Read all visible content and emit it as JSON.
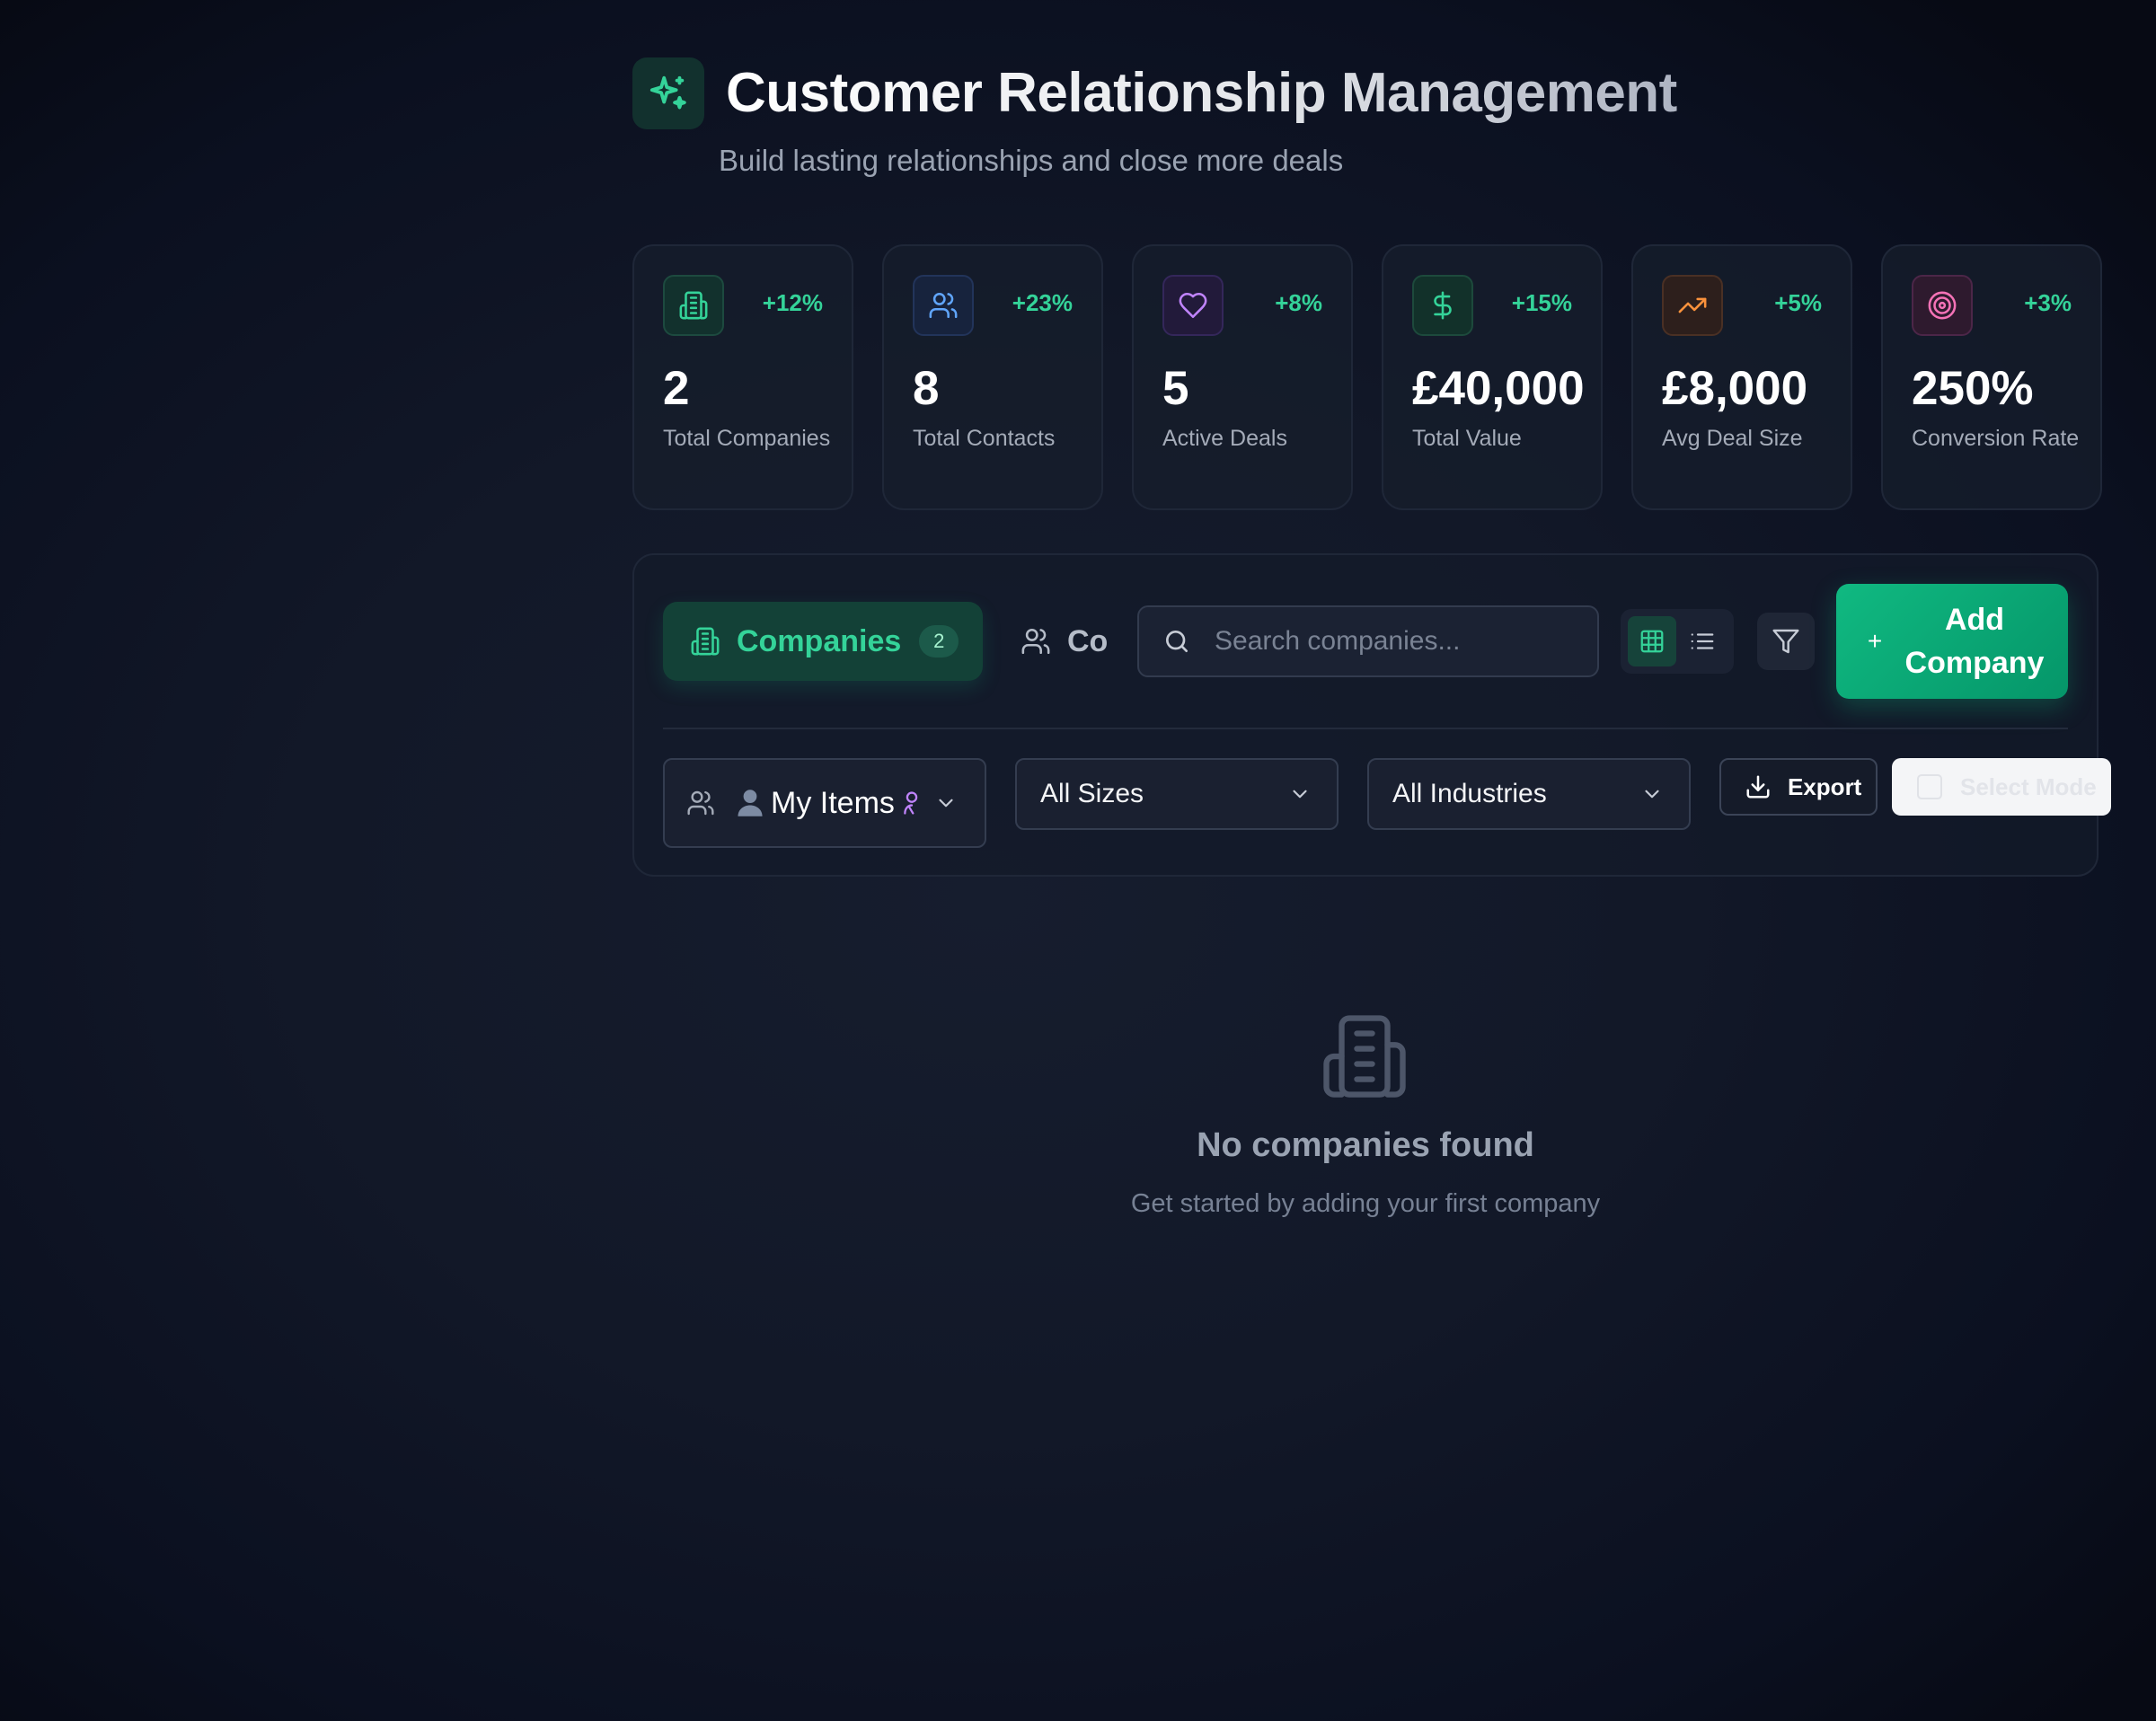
{
  "header": {
    "title": "Customer Relationship Management",
    "subtitle": "Build lasting relationships and close more deals",
    "logo_icon": "sparkles-icon"
  },
  "stats": [
    {
      "icon": "building-icon",
      "change": "+12%",
      "value": "2",
      "label": "Total Companies",
      "accent": "#34d399"
    },
    {
      "icon": "users-icon",
      "change": "+23%",
      "value": "8",
      "label": "Total Contacts",
      "accent": "#60a5fa"
    },
    {
      "icon": "heart-icon",
      "change": "+8%",
      "value": "5",
      "label": "Active Deals",
      "accent": "#c084fc"
    },
    {
      "icon": "dollar-icon",
      "change": "+15%",
      "value": "£40,000",
      "label": "Total Value",
      "accent": "#34d399"
    },
    {
      "icon": "trending-up-icon",
      "change": "+5%",
      "value": "£8,000",
      "label": "Avg Deal Size",
      "accent": "#fb923c"
    },
    {
      "icon": "target-icon",
      "change": "+3%",
      "value": "250%",
      "label": "Conversion Rate",
      "accent": "#f472b6"
    }
  ],
  "tabs": {
    "companies": {
      "label": "Companies",
      "count": "2",
      "icon": "building-icon"
    },
    "contacts": {
      "label": "Co",
      "icon": "users-icon"
    }
  },
  "search": {
    "placeholder": "Search companies...",
    "value": ""
  },
  "view_modes": {
    "active": "grid",
    "grid_icon": "grid-icon",
    "list_icon": "list-icon"
  },
  "filter_icon": "filter-icon",
  "add_company": {
    "plus": "+",
    "label": "Add Company"
  },
  "filters": {
    "owner": {
      "emoji": "👤",
      "label": "My Items",
      "icon": "users-icon"
    },
    "size": {
      "label": "All Sizes"
    },
    "industry": {
      "label": "All Industries"
    }
  },
  "export": {
    "label": "Export",
    "icon": "download-icon"
  },
  "select_mode": {
    "label": "Select Mode"
  },
  "empty_state": {
    "icon": "building-icon",
    "title": "No companies found",
    "subtitle": "Get started by adding your first company"
  },
  "colors": {
    "accent": "#10b981",
    "accent_text": "#34d399",
    "background": "#121828",
    "card": "#161d2c"
  }
}
